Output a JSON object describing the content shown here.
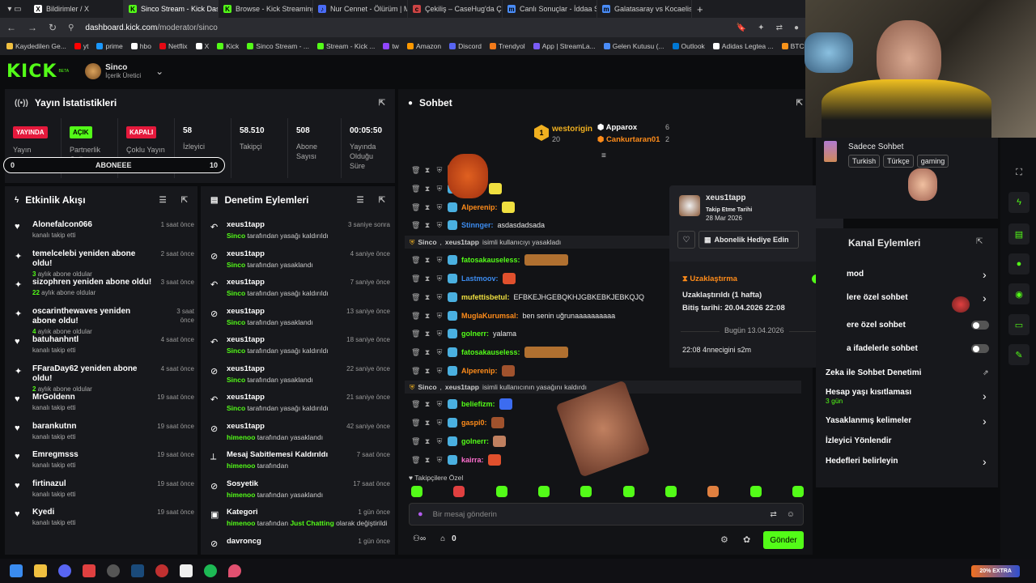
{
  "browser": {
    "tabs": [
      {
        "title": "Bildirimler / X",
        "icon": "X",
        "color": "#fff"
      },
      {
        "title": "Sinco Stream - Kick Dashboard",
        "icon": "K",
        "color": "#53fc18"
      },
      {
        "title": "Browse - Kick Streaming",
        "icon": "K",
        "color": "#53fc18"
      },
      {
        "title": "Nur Cennet - Ölürüm | Mu",
        "icon": "♪",
        "color": "#4a6cf7"
      },
      {
        "title": "Çekiliş – CaseHug'da Çekili",
        "icon": "c",
        "color": "#c44"
      },
      {
        "title": "Canlı Sonuçlar - İddaa Sonu",
        "icon": "m",
        "color": "#4a8cf7"
      },
      {
        "title": "Galatasaray vs Kocaelispor",
        "icon": "m",
        "color": "#4a8cf7"
      }
    ],
    "new_tab": "+",
    "url_host": "dashboard.kick.com",
    "url_path": "/moderator/sinco",
    "bookmarks": [
      {
        "label": "Kaydedilen Ge...",
        "color": "#f0c040"
      },
      {
        "label": "yt",
        "color": "#f00"
      },
      {
        "label": "prime",
        "color": "#1a98ff"
      },
      {
        "label": "hbo",
        "color": "#fff"
      },
      {
        "label": "Netflix",
        "color": "#e50914"
      },
      {
        "label": "X",
        "color": "#fff"
      },
      {
        "label": "Kick",
        "color": "#53fc18"
      },
      {
        "label": "Sinco Stream - ...",
        "color": "#53fc18"
      },
      {
        "label": "Stream - Kick ...",
        "color": "#53fc18"
      },
      {
        "label": "tw",
        "color": "#9146ff"
      },
      {
        "label": "Amazon",
        "color": "#ff9900"
      },
      {
        "label": "Discord",
        "color": "#5865f2"
      },
      {
        "label": "Trendyol",
        "color": "#f27a1a"
      },
      {
        "label": "App | StreamLa...",
        "color": "#7a5cf7"
      },
      {
        "label": "Gelen Kutusu (...",
        "color": "#4a8cf7"
      },
      {
        "label": "Outlook",
        "color": "#0078d4"
      },
      {
        "label": "Adidas Legtea ...",
        "color": "#fff"
      },
      {
        "label": "BTCUS",
        "color": "#f7931a"
      }
    ]
  },
  "header": {
    "logo": "KICK",
    "beta": "BETA",
    "username": "Sinco",
    "role": "İçerik Üretici"
  },
  "stats": {
    "title": "Yayın İstatistikleri",
    "items": [
      {
        "badge": "YAYINDA",
        "badge_color": "#e5193c",
        "label": "Yayın"
      },
      {
        "badge": "AÇIK",
        "badge_color": "#53fc18",
        "label": "Partnerlik Gelir Programı"
      },
      {
        "badge": "KAPALI",
        "badge_color": "#e5193c",
        "label": "Çoklu Yayın"
      },
      {
        "value": "58",
        "label": "İzleyici"
      },
      {
        "value": "58.510",
        "label": "Takipçi"
      },
      {
        "value": "508",
        "label": "Abone Sayısı"
      },
      {
        "value": "00:05:50",
        "label": "Yayında Olduğu Süre"
      }
    ],
    "sub_bar": {
      "min": "0",
      "label": "ABONEEE",
      "max": "10"
    }
  },
  "activity": {
    "title": "Etkinlik Akışı",
    "items": [
      {
        "icon": "heart",
        "name": "Alonefalcon066",
        "sub": "kanalı takip etti",
        "time": "1 saat önce"
      },
      {
        "icon": "star",
        "name": "temelcelebi yeniden abone oldu!",
        "sub_highlight": "3",
        "sub": "aylık abone oldular",
        "time": "2 saat önce"
      },
      {
        "icon": "star",
        "name": "sizophren yeniden abone oldu!",
        "sub_highlight": "22",
        "sub": "aylık abone oldular",
        "time": "3 saat önce"
      },
      {
        "icon": "star",
        "name": "oscarinthewaves yeniden abone oldu!",
        "sub_highlight": "4",
        "sub": "aylık abone oldular",
        "time": "3 saat önce"
      },
      {
        "icon": "heart",
        "name": "batuhanhntl",
        "sub": "kanalı takip etti",
        "time": "4 saat önce"
      },
      {
        "icon": "star",
        "name": "FFaraDay62 yeniden abone oldu!",
        "sub_highlight": "2",
        "sub": "aylık abone oldular",
        "time": "4 saat önce"
      },
      {
        "icon": "heart",
        "name": "MrGoldenn",
        "sub": "kanalı takip etti",
        "time": "19 saat önce"
      },
      {
        "icon": "heart",
        "name": "barankutnn",
        "sub": "kanalı takip etti",
        "time": "19 saat önce"
      },
      {
        "icon": "heart",
        "name": "Emregmsss",
        "sub": "kanalı takip etti",
        "time": "19 saat önce"
      },
      {
        "icon": "heart",
        "name": "firtinazul",
        "sub": "kanalı takip etti",
        "time": "19 saat önce"
      },
      {
        "icon": "heart",
        "name": "Kyedi",
        "sub": "kanalı takip etti",
        "time": "19 saat önce"
      }
    ]
  },
  "moderation": {
    "title": "Denetim Eylemleri",
    "items": [
      {
        "icon": "undo",
        "name": "xeus1tapp",
        "actor": "Sinco",
        "action": "tarafından yasağı kaldırıldı",
        "time": "3 saniye sonra"
      },
      {
        "icon": "ban",
        "name": "xeus1tapp",
        "actor": "Sinco",
        "action": "tarafından yasaklandı",
        "time": "4 saniye önce"
      },
      {
        "icon": "undo",
        "name": "xeus1tapp",
        "actor": "Sinco",
        "action": "tarafından yasağı kaldırıldı",
        "time": "7 saniye önce"
      },
      {
        "icon": "ban",
        "name": "xeus1tapp",
        "actor": "Sinco",
        "action": "tarafından yasaklandı",
        "time": "13 saniye önce"
      },
      {
        "icon": "undo",
        "name": "xeus1tapp",
        "actor": "Sinco",
        "action": "tarafından yasağı kaldırıldı",
        "time": "18 saniye önce"
      },
      {
        "icon": "ban",
        "name": "xeus1tapp",
        "actor": "Sinco",
        "action": "tarafından yasaklandı",
        "time": "22 saniye önce"
      },
      {
        "icon": "undo",
        "name": "xeus1tapp",
        "actor": "Sinco",
        "action": "tarafından yasağı kaldırıldı",
        "time": "21 saniye önce"
      },
      {
        "icon": "ban",
        "name": "xeus1tapp",
        "actor": "himenoo",
        "action": "tarafından yasaklandı",
        "time": "42 saniye önce"
      },
      {
        "icon": "unpin",
        "name": "Mesaj Sabitlemesi Kaldırıldı",
        "actor": "himenoo",
        "action": "tarafından",
        "time": "7 saat önce"
      },
      {
        "icon": "ban",
        "name": "Sosyetik",
        "actor": "himenoo",
        "action": "tarafından yasaklandı",
        "time": "17 saat önce"
      },
      {
        "icon": "category",
        "name": "Kategori",
        "actor": "himenoo",
        "action": "tarafından",
        "category": "Just Chatting",
        "action2": "olarak değiştirildi",
        "time": "1 gün önce"
      },
      {
        "icon": "ban",
        "name": "davroncg",
        "actor": "",
        "action": "",
        "time": "1 gün önce"
      }
    ]
  },
  "chat": {
    "title": "Sohbet",
    "leaderboard": {
      "first_name": "westorigin",
      "first_count": "20",
      "second_name": "Apparox",
      "second_count": "6",
      "third_name": "Cankurtaran01",
      "third_count": "2"
    },
    "messages": [
      {
        "name": "",
        "color": "#53fc18",
        "text": "",
        "emote": "#a0522d"
      },
      {
        "name": "xEscc",
        "color": "#53fc18",
        "text": "",
        "emote": "#f0e040"
      },
      {
        "name": "Alperenip",
        "color": "#ff8c1a",
        "text": "",
        "emote": "#f0e040"
      },
      {
        "name": "Stinnger",
        "color": "#3c8cf0",
        "text": "asdasdadsada"
      },
      {
        "system": true,
        "actor": "Sinco",
        "target": "xeus1tapp",
        "text": "isimli kullanıcıyı yasakladı"
      },
      {
        "name": "fatosakauseless",
        "color": "#53fc18",
        "text": "",
        "emote": "#b07030"
      },
      {
        "name": "Lastmoov",
        "color": "#3c8cf0",
        "text": "",
        "emote": "#e0502d"
      },
      {
        "name": "mufettisbetul",
        "color": "#f0e040",
        "text": "EFBKEJHGEBQKHJGBKEBKJEBKQJQ"
      },
      {
        "name": "MuglaKurumsal",
        "color": "#ff8c1a",
        "text": "ben senin uğrunaaaaaaaaaa"
      },
      {
        "name": "golnerr",
        "color": "#53fc18",
        "text": "yalama"
      },
      {
        "name": "fatosakauseless",
        "color": "#53fc18",
        "text": "",
        "emote": "#b07030"
      },
      {
        "name": "Alperenip",
        "color": "#ff8c1a",
        "text": "",
        "emote": "#a0522d"
      },
      {
        "system": true,
        "actor": "Sinco",
        "target": "xeus1tapp",
        "text": "isimli kullanıcının yasağını kaldırdı"
      },
      {
        "name": "beliefizm",
        "color": "#53fc18",
        "text": "",
        "emote": "#3c6cf0"
      },
      {
        "name": "gaspi0",
        "color": "#ff8c1a",
        "text": "",
        "emote": "#a0522d"
      },
      {
        "name": "golnerr",
        "color": "#53fc18",
        "text": "",
        "emote": "#c08060"
      },
      {
        "name": "kairra",
        "color": "#ff6fd0",
        "text": "",
        "emote": "#e0502d"
      }
    ],
    "followers_only": "Takipçilere Özel",
    "input_placeholder": "Bir mesaj gönderin",
    "count": "0",
    "send_label": "Gönder"
  },
  "user_popup": {
    "username": "xeus1tapp",
    "follow_label": "Takip Etme Tarihi",
    "follow_date": "28 Mar 2026",
    "gift_label": "Abonelik Hediye Edin",
    "timeout_title": "Uzaklaştırma",
    "timeout_status": "Uzaklaştırıldı (1 hafta)",
    "timeout_end": "Bitiş tarihi: 20.04.2026 22:08",
    "day_divider": "Bugün 13.04.2026",
    "history_entry": "22:08 4nnecigini s2m"
  },
  "channel_panel": {
    "chat_mode": "Sadece Sohbet",
    "tags": [
      "Turkish",
      "Türkçe",
      "gaming"
    ],
    "title": "Kanal Eylemleri",
    "rows": [
      {
        "label": "mod",
        "type": "chevron"
      },
      {
        "label": "lere özel sohbet",
        "type": "chevron"
      },
      {
        "label": "ere özel sohbet",
        "type": "toggle"
      },
      {
        "label": "a ifadelerle sohbet",
        "type": "toggle"
      },
      {
        "label": "Zeka ile Sohbet Denetimi",
        "type": "link"
      },
      {
        "label": "Hesap yaşı kısıtlaması",
        "sub": "3 gün",
        "type": "chevron"
      },
      {
        "label": "Yasaklanmış kelimeler",
        "type": "chevron"
      },
      {
        "label": "İzleyici Yönlendir",
        "type": "none"
      },
      {
        "label": "Hedefleri belirleyin",
        "type": "chevron"
      }
    ]
  },
  "taskbar": {
    "promo": "20% EXTRA"
  }
}
